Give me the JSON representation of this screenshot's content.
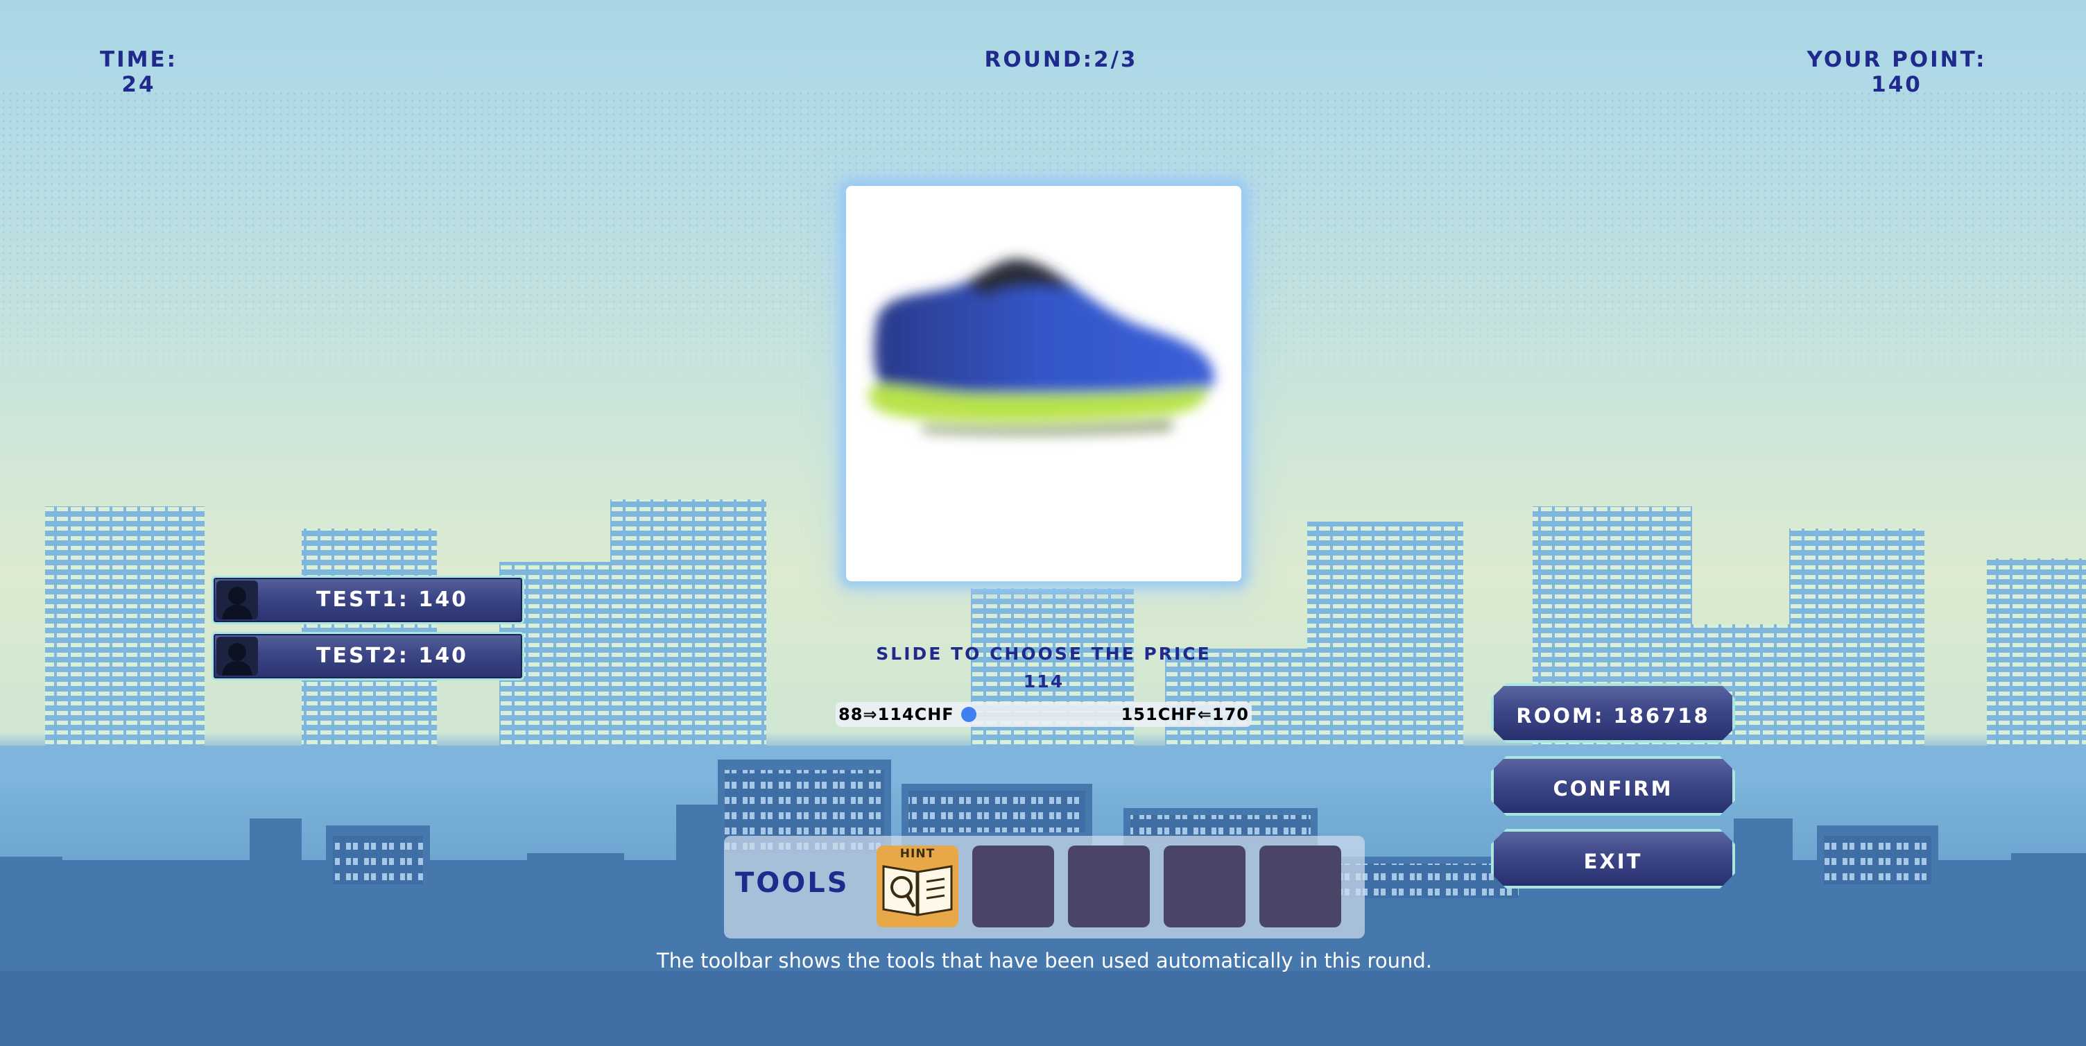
{
  "hud": {
    "time_label": "TIME:",
    "time_value": "24",
    "round_text": "ROUND:2/3",
    "points_label": "YOUR POINT:",
    "points_value": "140"
  },
  "players": [
    {
      "name": "TEST1: 140",
      "avatar": "silhouette-icon"
    },
    {
      "name": "TEST2: 140",
      "avatar": "silhouette-icon"
    }
  ],
  "product": {
    "description": "blurred running shoe",
    "icon": "shoe-image"
  },
  "slider": {
    "title": "SLIDE TO CHOOSE THE PRICE",
    "value": "114",
    "left_text": "88⇒114CHF",
    "right_text": "151CHF⇐170",
    "position": 0.0
  },
  "toolbar": {
    "label": "TOOLS",
    "slots": [
      {
        "label": "HINT",
        "icon": "hint-book-icon",
        "filled": true
      },
      {
        "label": "",
        "filled": false
      },
      {
        "label": "",
        "filled": false
      },
      {
        "label": "",
        "filled": false
      },
      {
        "label": "",
        "filled": false
      }
    ],
    "caption": "The toolbar shows the tools that have been used automatically in this round."
  },
  "buttons": {
    "room": "ROOM: 186718",
    "confirm": "CONFIRM",
    "exit": "EXIT"
  },
  "colors": {
    "hud_text": "#1f2a8c",
    "button_fill": "#3d4788",
    "button_border": "#a9e6df",
    "slider_thumb": "#3f7ff2",
    "hint_slot": "#e8a848",
    "empty_slot": "#4a4566"
  }
}
